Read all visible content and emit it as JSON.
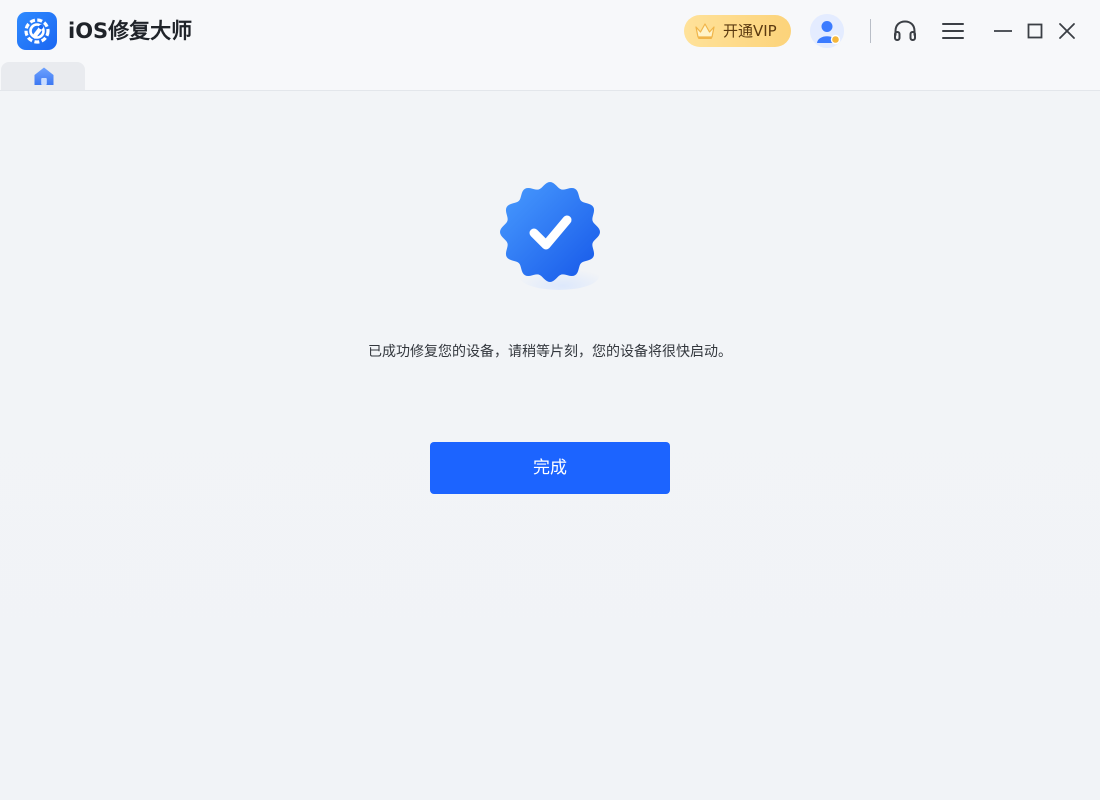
{
  "app": {
    "title": "iOS修复大师",
    "logo_icon": "wrench-gear-icon"
  },
  "header": {
    "vip_label": "开通VIP",
    "vip_icon": "crown-icon",
    "avatar_icon": "user-avatar-icon",
    "support_icon": "headset-icon",
    "menu_icon": "hamburger-menu-icon",
    "minimize_icon": "minimize-icon",
    "maximize_icon": "maximize-icon",
    "close_icon": "close-icon"
  },
  "tabs": [
    {
      "icon": "home-icon",
      "active": true
    }
  ],
  "main": {
    "status_icon": "verified-check-badge-icon",
    "message": "已成功修复您的设备，请稍等片刻，您的设备将很快启动。",
    "done_label": "完成"
  },
  "colors": {
    "accent": "#1c64ff",
    "vip_gold": "#fcd37a",
    "background": "#f1f3f7"
  }
}
